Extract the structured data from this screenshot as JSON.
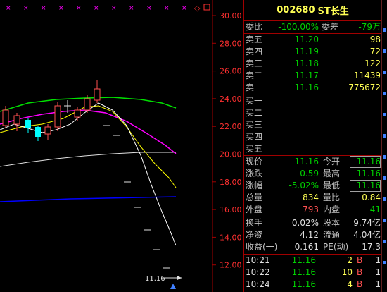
{
  "stock": {
    "code": "002680",
    "name": "ST长生"
  },
  "chart": {
    "y_ticks": [
      "30.00",
      "28.00",
      "26.00",
      "24.00",
      "22.00",
      "20.00",
      "18.00",
      "16.00",
      "14.00",
      "12.00"
    ],
    "last_price_marker": "11.16"
  },
  "order_ratio": {
    "ratio_label": "委比",
    "ratio_value": "-100.00%",
    "diff_label": "委差",
    "diff_value": "-79万"
  },
  "asks": [
    {
      "label": "卖五",
      "price": "11.20",
      "volume": "98"
    },
    {
      "label": "卖四",
      "price": "11.19",
      "volume": "72"
    },
    {
      "label": "卖三",
      "price": "11.18",
      "volume": "122"
    },
    {
      "label": "卖二",
      "price": "11.17",
      "volume": "11439"
    },
    {
      "label": "卖一",
      "price": "11.16",
      "volume": "775672"
    }
  ],
  "bids": [
    {
      "label": "买一"
    },
    {
      "label": "买二"
    },
    {
      "label": "买三"
    },
    {
      "label": "买四"
    },
    {
      "label": "买五"
    }
  ],
  "quote": {
    "current_label": "现价",
    "current": "11.16",
    "open_label": "今开",
    "open": "11.16",
    "change_label": "涨跌",
    "change": "-0.59",
    "high_label": "最高",
    "high": "11.16",
    "pct_label": "涨幅",
    "pct": "-5.02%",
    "low_label": "最低",
    "low": "11.16",
    "volume_label": "总量",
    "volume": "834",
    "vol_ratio_label": "量比",
    "vol_ratio": "0.84",
    "outer_label": "外盘",
    "outer": "793",
    "inner_label": "内盘",
    "inner": "41"
  },
  "fundamentals": {
    "turnover_label": "换手",
    "turnover": "0.02%",
    "equity_label": "股本",
    "equity": "9.74亿",
    "nav_label": "净资",
    "nav": "4.12",
    "float_label": "流通",
    "float": "4.04亿",
    "eps_label": "收益(一)",
    "eps": "0.161",
    "pe_label": "PE(动)",
    "pe": "17.3"
  },
  "ticks": [
    {
      "time": "10:21",
      "price": "11.16",
      "vol": "2",
      "side": "B",
      "count": "1"
    },
    {
      "time": "10:22",
      "price": "11.16",
      "vol": "10",
      "side": "B",
      "count": "1"
    },
    {
      "time": "10:24",
      "price": "11.16",
      "vol": "4",
      "side": "B",
      "count": "1"
    }
  ],
  "colors": {
    "up": "#ff5050",
    "down": "#00d000",
    "highlight": "#ffff54",
    "ma5": "#ffffff",
    "ma10": "#ffff00",
    "ma20": "#ff00ff",
    "ma30": "#00ff00",
    "ma60": "#ffffff",
    "ma120": "#0000ff"
  }
}
